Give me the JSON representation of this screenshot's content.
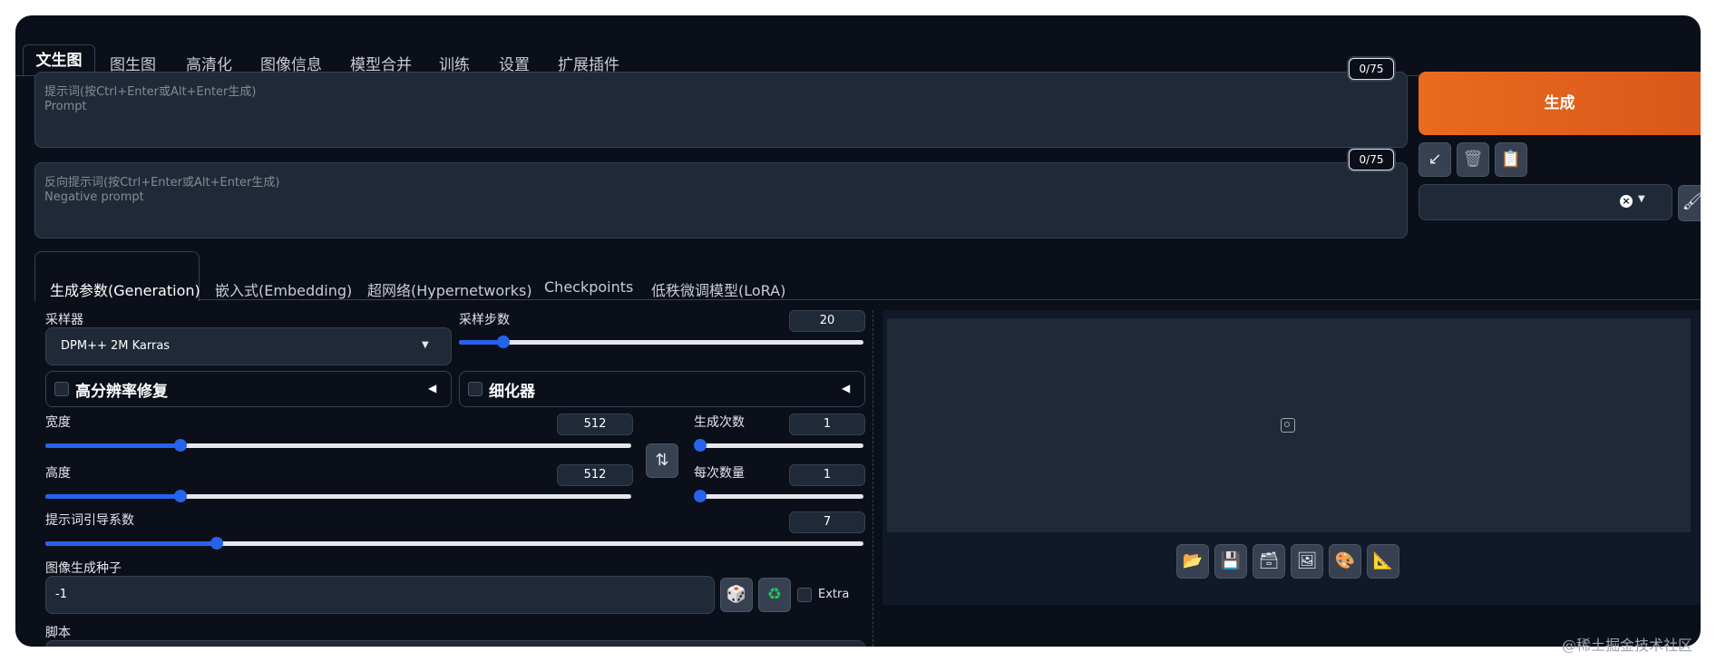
{
  "top_tabs": [
    {
      "label": "文生图",
      "active": true
    },
    {
      "label": "图生图"
    },
    {
      "label": "高清化"
    },
    {
      "label": "图像信息"
    },
    {
      "label": "模型合并"
    },
    {
      "label": "训练"
    },
    {
      "label": "设置"
    },
    {
      "label": "扩展插件"
    }
  ],
  "prompt": {
    "placeholder_line1": "提示词(按Ctrl+Enter或Alt+Enter生成)",
    "placeholder_line2": "Prompt",
    "token_count": "0/75"
  },
  "negative_prompt": {
    "placeholder_line1": "反向提示词(按Ctrl+Enter或Alt+Enter生成)",
    "placeholder_line2": "Negative prompt",
    "token_count": "0/75"
  },
  "generate_button": "生成",
  "style_select": {
    "value": ""
  },
  "sub_tabs": [
    {
      "label": "生成参数(Generation)",
      "active": true
    },
    {
      "label": "嵌入式(Embedding)"
    },
    {
      "label": "超网络(Hypernetworks)"
    },
    {
      "label": "Checkpoints"
    },
    {
      "label": "低秩微调模型(LoRA)"
    }
  ],
  "sampler": {
    "label": "采样器",
    "value": "DPM++ 2M Karras"
  },
  "steps": {
    "label": "采样步数",
    "value": "20",
    "fraction": 0.11
  },
  "hires_fix": {
    "label": "高分辨率修复",
    "checked": false
  },
  "refiner": {
    "label": "细化器",
    "checked": false
  },
  "width": {
    "label": "宽度",
    "value": "512",
    "fraction": 0.23
  },
  "height": {
    "label": "高度",
    "value": "512",
    "fraction": 0.23
  },
  "batch_count": {
    "label": "生成次数",
    "value": "1",
    "fraction": 0.0
  },
  "batch_size": {
    "label": "每次数量",
    "value": "1",
    "fraction": 0.0
  },
  "cfg_scale": {
    "label": "提示词引导系数",
    "value": "7",
    "fraction": 0.21
  },
  "seed": {
    "label": "图像生成种子",
    "value": "-1",
    "extra_label": "Extra",
    "extra_checked": false
  },
  "script": {
    "label": "脚本"
  },
  "output_tools": [
    "folder-icon",
    "save-icon",
    "zip-icon",
    "send-to-img2img-icon",
    "send-to-inpaint-icon",
    "send-to-extras-icon"
  ],
  "watermark": "@稀土掘金技术社区",
  "colors": {
    "accent": "#2563eb",
    "generate": "#e8661e",
    "bg": "#0b0f19",
    "panel": "#1f2937"
  }
}
